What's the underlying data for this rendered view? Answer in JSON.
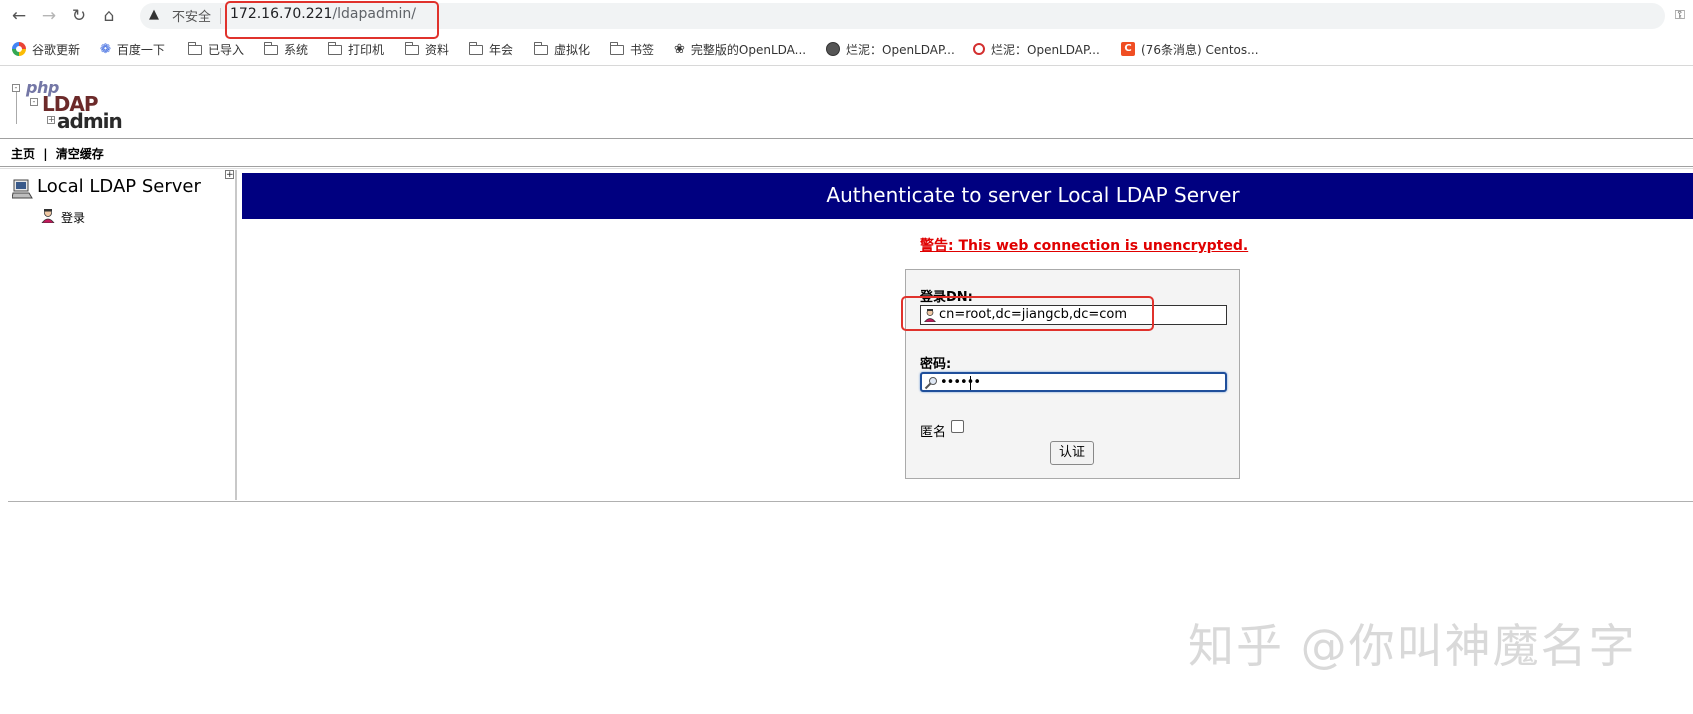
{
  "browser": {
    "insecure_label": "不安全",
    "url_host": "172.16.70.221",
    "url_path": "/ldapadmin/",
    "nav_icons": [
      "back-icon",
      "forward-icon",
      "reload-icon",
      "home-icon"
    ]
  },
  "bookmarks": [
    {
      "label": "谷歌更新",
      "icon": "chrome-icon"
    },
    {
      "label": "百度一下",
      "icon": "baidu-icon"
    },
    {
      "label": "已导入",
      "icon": "folder-icon"
    },
    {
      "label": "系统",
      "icon": "folder-icon"
    },
    {
      "label": "打印机",
      "icon": "folder-icon"
    },
    {
      "label": "资料",
      "icon": "folder-icon"
    },
    {
      "label": "年会",
      "icon": "folder-icon"
    },
    {
      "label": "虚拟化",
      "icon": "folder-icon"
    },
    {
      "label": "书签",
      "icon": "folder-icon"
    },
    {
      "label": "完整版的OpenLDA...",
      "icon": "link-icon"
    },
    {
      "label": "烂泥：OpenLDAP...",
      "icon": "globe-icon"
    },
    {
      "label": "烂泥：OpenLDAP...",
      "icon": "red-ring-icon"
    },
    {
      "label": "(76条消息) Centos...",
      "icon": "csdn-icon"
    }
  ],
  "logo": {
    "php": "php",
    "ldap": "LDAP",
    "admin": "admin"
  },
  "menu": {
    "home": "主页",
    "separator": "|",
    "clear_cache": "清空缓存"
  },
  "tree": {
    "server_name": "Local LDAP Server",
    "login_label": "登录",
    "expand_symbol": "+"
  },
  "auth": {
    "title": "Authenticate to server Local LDAP Server",
    "warning": "警告: This web connection is unencrypted.",
    "dn_label": "登录DN:",
    "dn_value": "cn=root,dc=jiangcb,dc=com",
    "password_label": "密码:",
    "password_value": "••••••",
    "anonymous_label": "匿名",
    "anonymous_checked": false,
    "submit_label": "认证"
  },
  "watermark": "知乎 @你叫神魔名字",
  "colors": {
    "banner": "#000080",
    "warning": "#e00000",
    "highlight": "#e0322c"
  }
}
